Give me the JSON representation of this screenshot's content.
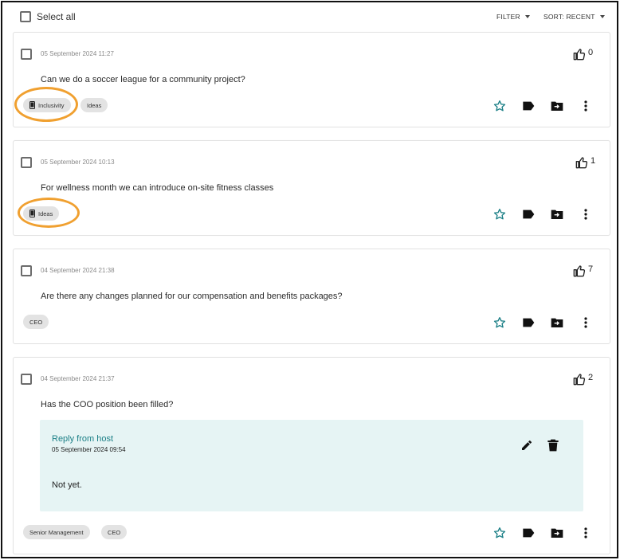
{
  "toolbar": {
    "select_all": "Select all",
    "filter": "FILTER",
    "sort": "SORT: RECENT"
  },
  "questions": [
    {
      "date": "05 September 2024 11:27",
      "text": "Can we do a soccer league for a community project?",
      "likes": "0",
      "tags": [
        "Inclusivity",
        "Ideas"
      ]
    },
    {
      "date": "05 September 2024 10:13",
      "text": "For wellness month we can introduce on-site fitness classes",
      "likes": "1",
      "tags": [
        "Ideas"
      ]
    },
    {
      "date": "04 September 2024 21:38",
      "text": "Are there any changes planned for our compensation and benefits packages?",
      "likes": "7",
      "tags": [
        "CEO"
      ]
    },
    {
      "date": "04 September 2024 21:37",
      "text": "Has the COO position been filled?",
      "likes": "2",
      "tags": [
        "Senior Management",
        "CEO"
      ],
      "reply": {
        "title": "Reply from host",
        "date": "05 September 2024 09:54",
        "text": "Not yet."
      }
    }
  ],
  "icons": {
    "like": "thumbs-up-icon",
    "star": "star-icon",
    "label": "label-icon",
    "move": "move-to-folder-icon",
    "more": "more-vert-icon",
    "device": "phone-icon",
    "edit": "pencil-icon",
    "delete": "trash-icon"
  },
  "colors": {
    "accent": "#1b7f86",
    "reply_bg": "#e6f4f4",
    "highlight": "#f0a030",
    "chip_bg": "#e3e3e3"
  }
}
